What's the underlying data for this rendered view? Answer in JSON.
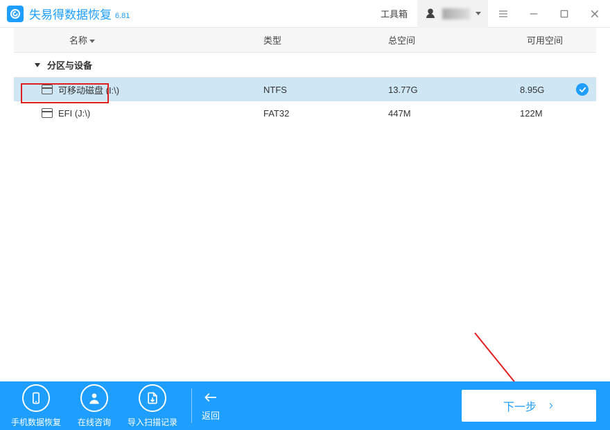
{
  "app": {
    "title": "失易得数据恢复",
    "version": "6.81"
  },
  "titlebar": {
    "toolbox": "工具箱"
  },
  "columns": {
    "name": "名称",
    "type": "类型",
    "total": "总空间",
    "available": "可用空间"
  },
  "section": {
    "title": "分区与设备"
  },
  "rows": [
    {
      "name": "可移动磁盘 (I:\\)",
      "type": "NTFS",
      "total": "13.77G",
      "available": "8.95G",
      "selected": true,
      "checked": true
    },
    {
      "name": "EFI (J:\\)",
      "type": "FAT32",
      "total": "447M",
      "available": "122M",
      "selected": false,
      "checked": false
    }
  ],
  "footer": {
    "phone": "手机数据恢复",
    "online": "在线咨询",
    "import": "导入扫描记录",
    "back": "返回",
    "next": "下一步"
  }
}
